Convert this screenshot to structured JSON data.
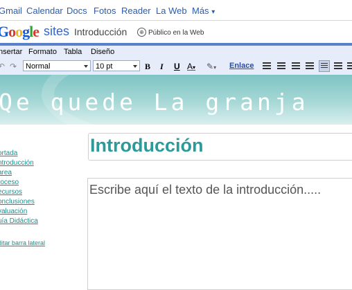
{
  "gbar": {
    "links": [
      "Gmail",
      "Calendar",
      "Docs",
      "Fotos",
      "Reader",
      "La Web",
      "Más"
    ],
    "more_caret": "▾"
  },
  "header": {
    "logo_letters": [
      "G",
      "o",
      "o",
      "g",
      "l",
      "e"
    ],
    "logo_colors": [
      "#1a5ad8",
      "#d63b2b",
      "#f0b323",
      "#1a5ad8",
      "#3a9e3a",
      "#d63b2b"
    ],
    "product": "sites",
    "page_name": "Introducción",
    "visibility": "Público en la Web"
  },
  "menu": [
    "nsertar",
    "Formato",
    "Tabla",
    "Diseño"
  ],
  "toolbar": {
    "style_value": "Normal",
    "size_value": "10 pt",
    "bold": "B",
    "italic": "I",
    "underline": "U",
    "text_color": "A",
    "link": "Enlace"
  },
  "banner": {
    "title": "Qe quede La granja"
  },
  "sidebar": {
    "items": [
      "ortada",
      "ntroducción",
      "area",
      "roceso",
      "ecursos",
      "onclusiones",
      "valuación",
      "uía Didáctica"
    ],
    "edit": "ditar barra lateral"
  },
  "content": {
    "title": "Introducción",
    "body": "Escribe aquí el texto de la introducción....."
  },
  "colors": {
    "accent_teal": "#2d9a9a",
    "link_blue": "#2a5db0",
    "toolbar_bg": "#e6ecf9"
  }
}
